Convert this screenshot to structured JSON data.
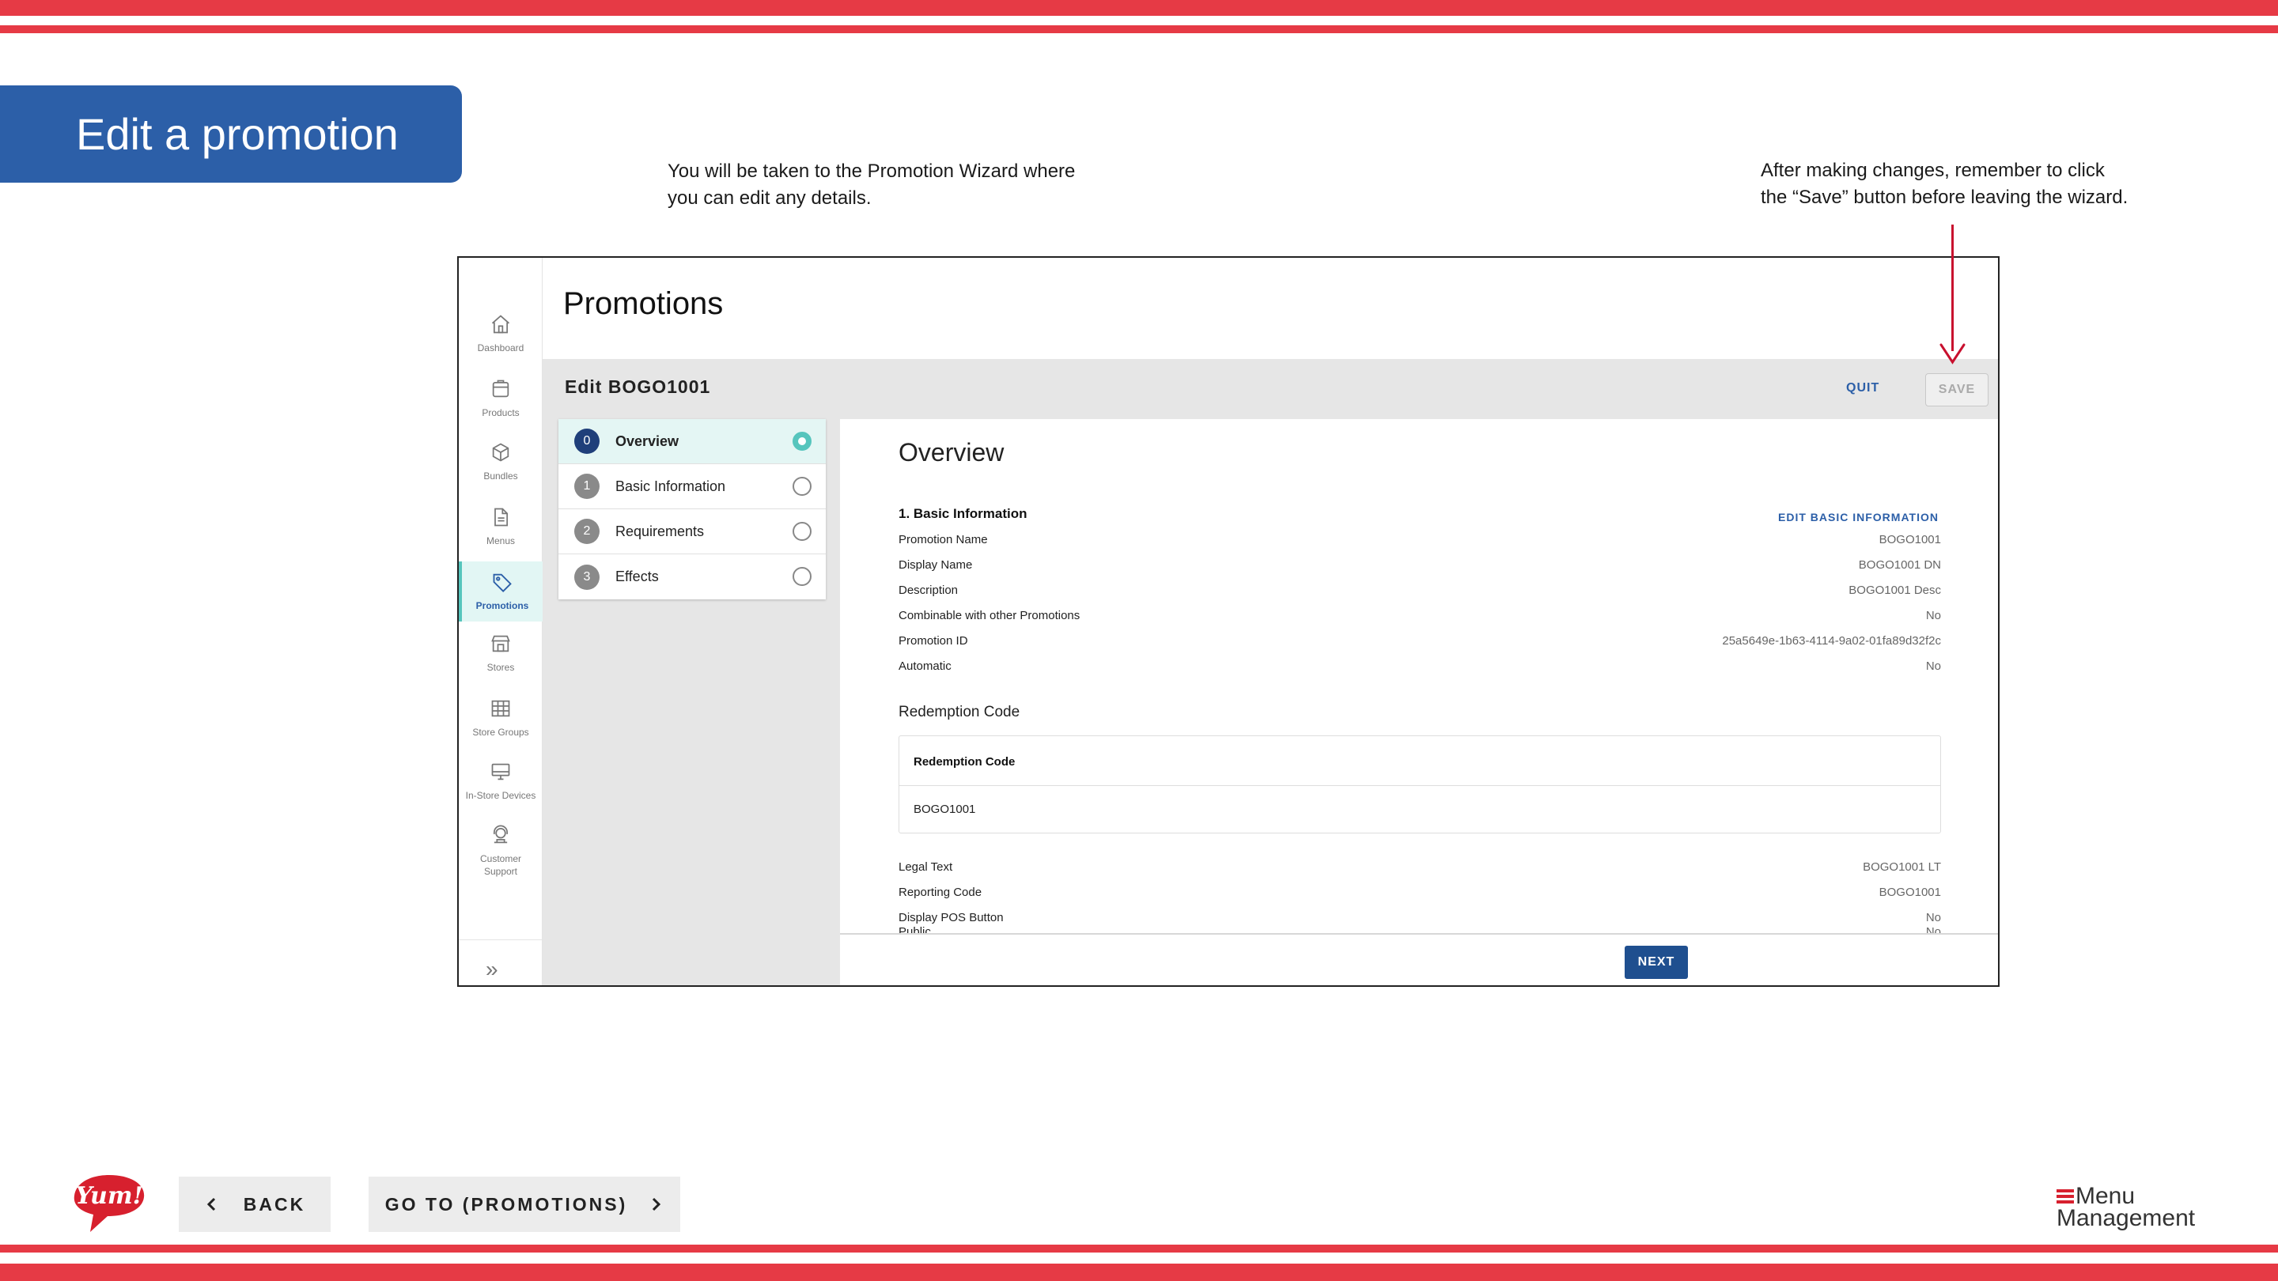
{
  "slide": {
    "title": "Edit a promotion",
    "callout_left": [
      "You will be taken to the Promotion Wizard where",
      "you can edit any details."
    ],
    "callout_right": [
      "After making changes, remember to click",
      "the “Save” button before leaving the wizard."
    ]
  },
  "app": {
    "page_title": "Promotions",
    "edit_title": "Edit BOGO1001",
    "quit_label": "QUIT",
    "save_label": "SAVE",
    "next_label": "NEXT",
    "nav": [
      {
        "label": "Dashboard",
        "icon": "home-icon"
      },
      {
        "label": "Products",
        "icon": "box-icon"
      },
      {
        "label": "Bundles",
        "icon": "cube-icon"
      },
      {
        "label": "Menus",
        "icon": "document-icon"
      },
      {
        "label": "Promotions",
        "icon": "tag-icon",
        "active": true
      },
      {
        "label": "Stores",
        "icon": "store-icon"
      },
      {
        "label": "Store Groups",
        "icon": "grid-icon"
      },
      {
        "label": "In-Store Devices",
        "icon": "monitor-icon"
      },
      {
        "label": "Customer Support",
        "icon": "headset-icon"
      }
    ],
    "steps": [
      {
        "num": "0",
        "label": "Overview",
        "active": true
      },
      {
        "num": "1",
        "label": "Basic Information"
      },
      {
        "num": "2",
        "label": "Requirements"
      },
      {
        "num": "3",
        "label": "Effects"
      }
    ],
    "overview": {
      "title": "Overview",
      "section": "1. Basic Information",
      "edit_link": "EDIT BASIC INFORMATION",
      "fields": [
        {
          "label": "Promotion Name",
          "value": "BOGO1001"
        },
        {
          "label": "Display Name",
          "value": "BOGO1001 DN"
        },
        {
          "label": "Description",
          "value": "BOGO1001 Desc"
        },
        {
          "label": "Combinable with other Promotions",
          "value": "No"
        },
        {
          "label": "Promotion ID",
          "value": "25a5649e-1b63-4114-9a02-01fa89d32f2c"
        },
        {
          "label": "Automatic",
          "value": "No"
        }
      ],
      "redemption_heading": "Redemption Code",
      "redemption_column": "Redemption Code",
      "redemption_value": "BOGO1001",
      "fields2": [
        {
          "label": "Legal Text",
          "value": "BOGO1001 LT"
        },
        {
          "label": "Reporting Code",
          "value": "BOGO1001"
        },
        {
          "label": "Display POS Button",
          "value": "No"
        },
        {
          "label": "Public",
          "value": "No"
        }
      ]
    }
  },
  "footer": {
    "back_label": "BACK",
    "goto_label": "GO TO (PROMOTIONS)",
    "yum_logo": "Yum!",
    "mm_logo_line1": "Menu",
    "mm_logo_line2": "Management"
  },
  "colors": {
    "stripe": "#e63a45",
    "badge": "#2c5fa8",
    "accent_teal": "#56c5bd",
    "primary_navy": "#1f4f8f",
    "arrow": "#c8102e"
  }
}
